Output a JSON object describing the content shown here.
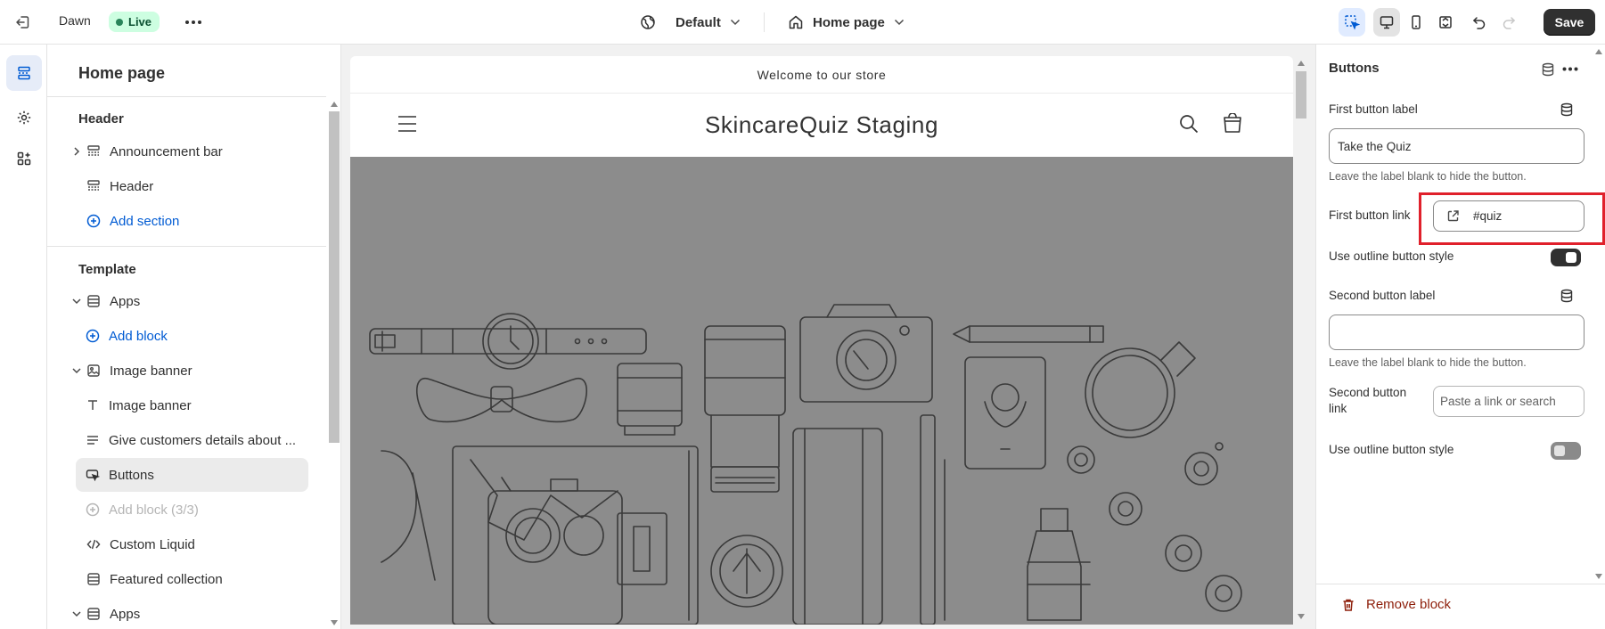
{
  "topbar": {
    "theme_name": "Dawn",
    "live_badge": "Live",
    "theme_select": "Default",
    "page_select": "Home page",
    "save_label": "Save"
  },
  "sidebar": {
    "title": "Home page",
    "header_group": "Header",
    "header_items": [
      {
        "label": "Announcement bar"
      },
      {
        "label": "Header"
      }
    ],
    "add_section": "Add section",
    "template_group": "Template",
    "template_items": [
      {
        "label": "Apps"
      },
      {
        "label": "Add block"
      },
      {
        "label": "Image banner"
      },
      {
        "label": "Image banner"
      },
      {
        "label": "Give customers details about ..."
      },
      {
        "label": "Buttons"
      },
      {
        "label": "Add block (3/3)"
      },
      {
        "label": "Custom Liquid"
      },
      {
        "label": "Featured collection"
      },
      {
        "label": "Apps"
      }
    ]
  },
  "preview": {
    "announcement": "Welcome to our store",
    "store_name": "SkincareQuiz Staging"
  },
  "panel": {
    "title": "Buttons",
    "first_button_label": "First button label",
    "first_button_value": "Take the Quiz",
    "first_help": "Leave the label blank to hide the button.",
    "first_link_label": "First button link",
    "first_link_value": "#quiz",
    "outline_label_1": "Use outline button style",
    "outline_1_on": true,
    "second_button_label": "Second button label",
    "second_button_value": "",
    "second_help": "Leave the label blank to hide the button.",
    "second_link_label_line1": "Second button",
    "second_link_label_line2": "link",
    "second_link_placeholder": "Paste a link or search",
    "outline_label_2": "Use outline button style",
    "outline_2_on": false,
    "remove_block": "Remove block"
  },
  "colors": {
    "accent_blue": "#005bd3",
    "save_bg": "#303030",
    "live_bg": "#cdfee1",
    "banner_bg": "#8c8c8c",
    "highlight": "#e0202b",
    "critical": "#8e1f0b"
  }
}
